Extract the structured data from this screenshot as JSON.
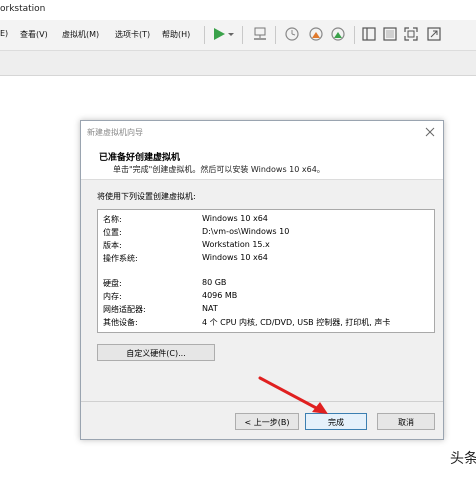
{
  "window": {
    "title": "orkstation"
  },
  "menu": {
    "items": [
      "E)",
      "查看(V)",
      "虚拟机(M)",
      "选项卡(T)",
      "帮助(H)"
    ]
  },
  "toolbar": {
    "icons": [
      "play-icon",
      "dropdown-icon",
      "network-icon",
      "snapshot-icon",
      "snapshot-revert-icon",
      "snapshot-manager-icon",
      "sidebar-icon",
      "console-icon",
      "fullscreen-icon",
      "unity-icon"
    ],
    "accent_color": "#3aa24a"
  },
  "dialog": {
    "title": "新建虚拟机向导",
    "heading": "已准备好创建虚拟机",
    "subheading": "单击\"完成\"创建虚拟机。然后可以安装 Windows 10 x64。",
    "intro": "将使用下列设置创建虚拟机:",
    "settings": [
      {
        "label": "名称:",
        "value": "Windows 10 x64"
      },
      {
        "label": "位置:",
        "value": "D:\\vm-os\\Windows 10"
      },
      {
        "label": "版本:",
        "value": "Workstation 15.x"
      },
      {
        "label": "操作系统:",
        "value": "Windows 10 x64"
      },
      {
        "label": "硬盘:",
        "value": "80 GB"
      },
      {
        "label": "内存:",
        "value": "4096 MB"
      },
      {
        "label": "网络适配器:",
        "value": "NAT"
      },
      {
        "label": "其他设备:",
        "value": "4 个 CPU 内核, CD/DVD, USB 控制器, 打印机, 声卡"
      }
    ],
    "customize_label": "自定义硬件(C)...",
    "back_label": "< 上一步(B)",
    "finish_label": "完成",
    "cancel_label": "取消"
  },
  "watermark": {
    "text": "头条"
  },
  "annotation": {
    "arrow_color": "#e02020"
  }
}
